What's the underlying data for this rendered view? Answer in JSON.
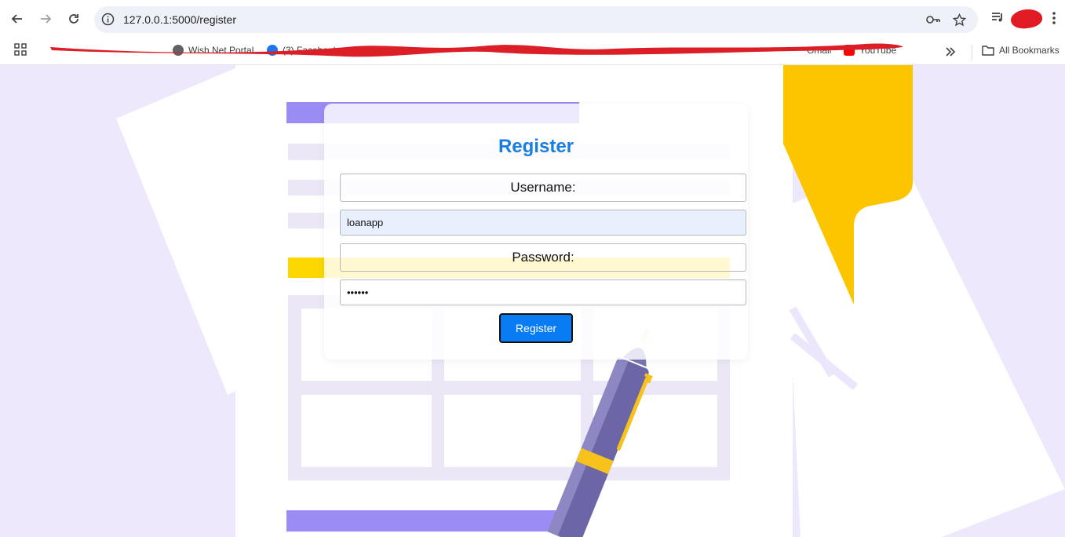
{
  "browser": {
    "url": "127.0.0.1:5000/register",
    "bookmarks": [
      {
        "label": "Wish Net Portal"
      },
      {
        "label": "(3) Facebook"
      },
      {
        "label": "Gmail"
      },
      {
        "label": "YouTube"
      }
    ],
    "all_bookmarks": "All Bookmarks"
  },
  "form": {
    "title": "Register",
    "username_label": "Username:",
    "username_value": "loanapp",
    "password_label": "Password:",
    "password_value": "••••••",
    "submit_label": "Register"
  },
  "colors": {
    "accent": "#1a7ee0",
    "button": "#0a7cf3",
    "background": "#ede8fb"
  }
}
